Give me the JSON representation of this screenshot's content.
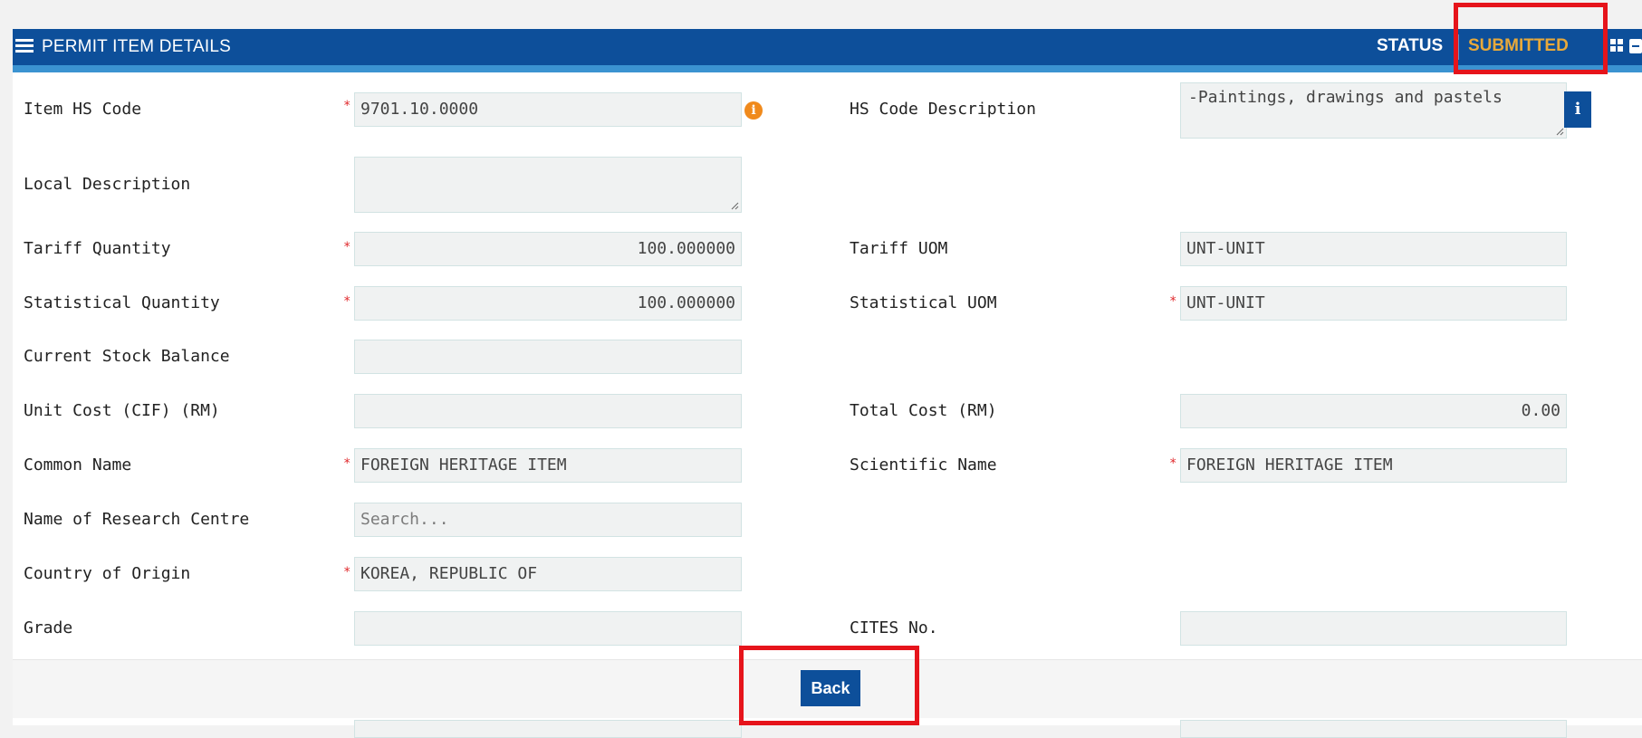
{
  "header": {
    "title": "PERMIT ITEM DETAILS",
    "status_label": "STATUS",
    "status_value": "SUBMITTED"
  },
  "colors": {
    "header_bg": "#0d4f9a",
    "header_stripe": "#3b93d1",
    "status_value": "#e8a93a",
    "required_marker": "#e0282b",
    "highlight": "#e6141b"
  },
  "icons": {
    "menu": "menu-icon",
    "grid": "grid-icon",
    "collapse": "collapse-icon",
    "warning_info": "info-circle-icon",
    "info": "info-icon"
  },
  "required_marker": "*",
  "fields": {
    "item_hs_code": {
      "label": "Item HS Code",
      "value": "9701.10.0000"
    },
    "hs_code_description": {
      "label": "HS Code Description",
      "value": "-Paintings, drawings and pastels"
    },
    "local_description": {
      "label": "Local Description",
      "value": ""
    },
    "tariff_quantity": {
      "label": "Tariff Quantity",
      "value": "100.000000"
    },
    "tariff_uom": {
      "label": "Tariff UOM",
      "value": "UNT-UNIT"
    },
    "statistical_quantity": {
      "label": "Statistical Quantity",
      "value": "100.000000"
    },
    "statistical_uom": {
      "label": "Statistical UOM",
      "value": "UNT-UNIT"
    },
    "current_stock_balance": {
      "label": "Current Stock Balance",
      "value": ""
    },
    "unit_cost": {
      "label": "Unit Cost (CIF) (RM)",
      "value": ""
    },
    "total_cost": {
      "label": "Total Cost (RM)",
      "value": "0.00"
    },
    "common_name": {
      "label": "Common Name",
      "value": "FOREIGN HERITAGE ITEM"
    },
    "scientific_name": {
      "label": "Scientific Name",
      "value": "FOREIGN HERITAGE ITEM"
    },
    "research_centre": {
      "label": "Name of Research Centre",
      "placeholder": "Search..."
    },
    "country_of_origin": {
      "label": "Country of Origin",
      "value": "KOREA, REPUBLIC OF"
    },
    "grade": {
      "label": "Grade",
      "value": ""
    },
    "cites_no": {
      "label": "CITES No.",
      "value": ""
    }
  },
  "footer": {
    "back_label": "Back"
  }
}
